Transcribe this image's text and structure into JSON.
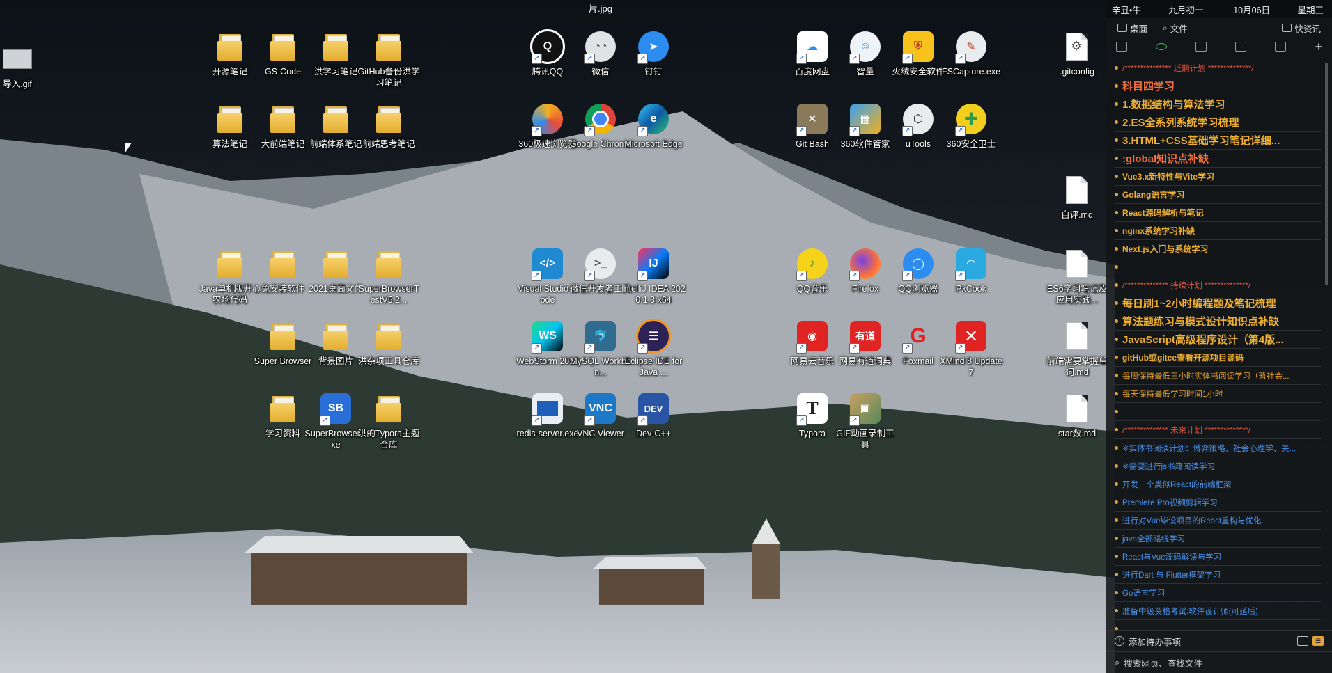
{
  "wallpaper_filename": "片.jpg",
  "desktop_icons": [
    {
      "label": "导入.gif",
      "kind": "gif"
    },
    {
      "label": "开源笔记",
      "kind": "folder"
    },
    {
      "label": "GS-Code",
      "kind": "folder"
    },
    {
      "label": "洪学习笔记",
      "kind": "folder"
    },
    {
      "label": "GitHub备份洪学习笔记",
      "kind": "folder"
    },
    {
      "label": "算法笔记",
      "kind": "folder"
    },
    {
      "label": "大前端笔记",
      "kind": "folder"
    },
    {
      "label": "前端体系笔记",
      "kind": "folder"
    },
    {
      "label": "前端思考笔记",
      "kind": "folder"
    },
    {
      "label": "Java单机版开心农场代码",
      "kind": "folder"
    },
    {
      "label": "免安装软件",
      "kind": "folder"
    },
    {
      "label": "2021桌面文件",
      "kind": "folder"
    },
    {
      "label": "SuperBrowserTestV5.2...",
      "kind": "folder"
    },
    {
      "label": "Super Browser",
      "kind": "folder"
    },
    {
      "label": "背景图片",
      "kind": "folder"
    },
    {
      "label": "洪杂项工具仓库",
      "kind": "folder"
    },
    {
      "label": "学习资料",
      "kind": "folder"
    },
    {
      "label": "SuperBrowser.exe",
      "kind": "app"
    },
    {
      "label": "洪的Typora主题合库",
      "kind": "folder"
    },
    {
      "label": "腾讯QQ",
      "kind": "app"
    },
    {
      "label": "微信",
      "kind": "app"
    },
    {
      "label": "钉钉",
      "kind": "app"
    },
    {
      "label": "360极速浏览器",
      "kind": "app"
    },
    {
      "label": "Google Chrome",
      "kind": "app"
    },
    {
      "label": "Microsoft Edge",
      "kind": "app"
    },
    {
      "label": "Visual Studio Code",
      "kind": "app"
    },
    {
      "label": "微信开发者工具",
      "kind": "app"
    },
    {
      "label": "IntelliJ IDEA 2020.1.3 x64",
      "kind": "app"
    },
    {
      "label": "WebStorm 2018",
      "kind": "app"
    },
    {
      "label": "MySQL Workben...",
      "kind": "app"
    },
    {
      "label": "Eclipse IDE for Java ...",
      "kind": "app"
    },
    {
      "label": "redis-server.exe",
      "kind": "app"
    },
    {
      "label": "VNC Viewer",
      "kind": "app"
    },
    {
      "label": "Dev-C++",
      "kind": "app"
    },
    {
      "label": "百度网盘",
      "kind": "app"
    },
    {
      "label": "智量",
      "kind": "app"
    },
    {
      "label": "火绒安全软件",
      "kind": "app"
    },
    {
      "label": "FSCapture.exe",
      "kind": "app"
    },
    {
      "label": "Git Bash",
      "kind": "app"
    },
    {
      "label": "360软件管家",
      "kind": "app"
    },
    {
      "label": "uTools",
      "kind": "app"
    },
    {
      "label": "360安全卫士",
      "kind": "app"
    },
    {
      "label": "QQ音乐",
      "kind": "app"
    },
    {
      "label": "Firefox",
      "kind": "app"
    },
    {
      "label": "QQ浏览器",
      "kind": "app"
    },
    {
      "label": "PxCook",
      "kind": "app"
    },
    {
      "label": "网易云音乐",
      "kind": "app"
    },
    {
      "label": "网易有道词典",
      "kind": "app"
    },
    {
      "label": "Foxmail",
      "kind": "app"
    },
    {
      "label": "XMind 8 Update 7",
      "kind": "app"
    },
    {
      "label": "Typora",
      "kind": "app"
    },
    {
      "label": "GIF动画录制工具",
      "kind": "app"
    },
    {
      "label": ".gitconfig",
      "kind": "file"
    },
    {
      "label": "自评.md",
      "kind": "file"
    },
    {
      "label": "ES6学习笔记及应用实践...",
      "kind": "file"
    },
    {
      "label": "前端需要掌握单词.md",
      "kind": "file"
    },
    {
      "label": "star数.md",
      "kind": "file"
    }
  ],
  "panel": {
    "calendar": {
      "ganzhi": "辛丑•牛",
      "lunar": "九月初一.",
      "date": "10月06日",
      "weekday": "星期三"
    },
    "tabs": {
      "desktop": "桌面",
      "files": "文件",
      "quick": "快资讯"
    },
    "todos": [
      {
        "text": "/***************  近期计划  **************/",
        "style": "t-head"
      },
      {
        "text": "科目四学习",
        "style": "t-big-red"
      },
      {
        "text": "1.数据结构与算法学习",
        "style": "t-big"
      },
      {
        "text": "2.ES全系列系统学习梳理",
        "style": "t-big"
      },
      {
        "text": "3.HTML+CSS基础学习笔记详细...",
        "style": "t-big"
      },
      {
        "text": ":global知识点补缺",
        "style": "t-big-red"
      },
      {
        "text": "Vue3.x新特性与Vite学习",
        "style": "t-mid"
      },
      {
        "text": "Golang语言学习",
        "style": "t-mid"
      },
      {
        "text": "React源码解析与笔记",
        "style": "t-mid"
      },
      {
        "text": "nginx系统学习补缺",
        "style": "t-mid"
      },
      {
        "text": "Next.js入门与系统学习",
        "style": "t-mid"
      },
      {
        "text": "",
        "style": "t-small"
      },
      {
        "text": "/**************  持续计划  **************/",
        "style": "t-head"
      },
      {
        "text": "每日刷1~2小时编程题及笔记梳理",
        "style": "t-big"
      },
      {
        "text": "算法题练习与模式设计知识点补缺",
        "style": "t-big"
      },
      {
        "text": "JavaScript高级程序设计（第4版...",
        "style": "t-big"
      },
      {
        "text": "gitHub或gitee查看开源项目源码",
        "style": "t-mid"
      },
      {
        "text": "每周保持最低三小时实体书阅读学习（暂社会...",
        "style": "t-small"
      },
      {
        "text": "每天保持最低学习时间1小时",
        "style": "t-small"
      },
      {
        "text": "",
        "style": "t-small"
      },
      {
        "text": "/**************  未来计划  **************/",
        "style": "t-head"
      },
      {
        "text": "※实体书阅读计划：博弈策略、社会心理学、关...",
        "style": "t-blue"
      },
      {
        "text": "※需要进行js书籍阅读学习",
        "style": "t-blue"
      },
      {
        "text": "开发一个类似React的前端框架",
        "style": "t-blue"
      },
      {
        "text": "Premiere Pro视频剪辑学习",
        "style": "t-blue"
      },
      {
        "text": "进行对Vue毕设项目的React重构与优化",
        "style": "t-blue"
      },
      {
        "text": "java全部路线学习",
        "style": "t-blue"
      },
      {
        "text": "React与Vue源码解读与学习",
        "style": "t-blue"
      },
      {
        "text": "进行Dart 与 Flutter框架学习",
        "style": "t-blue"
      },
      {
        "text": "Go语言学习",
        "style": "t-blue"
      },
      {
        "text": "准备中级资格考试:软件设计师(可延后)",
        "style": "t-blue"
      },
      {
        "text": "",
        "style": "t-small"
      }
    ],
    "add_todo": "添加待办事项",
    "search_placeholder": "搜索网页、查找文件"
  }
}
